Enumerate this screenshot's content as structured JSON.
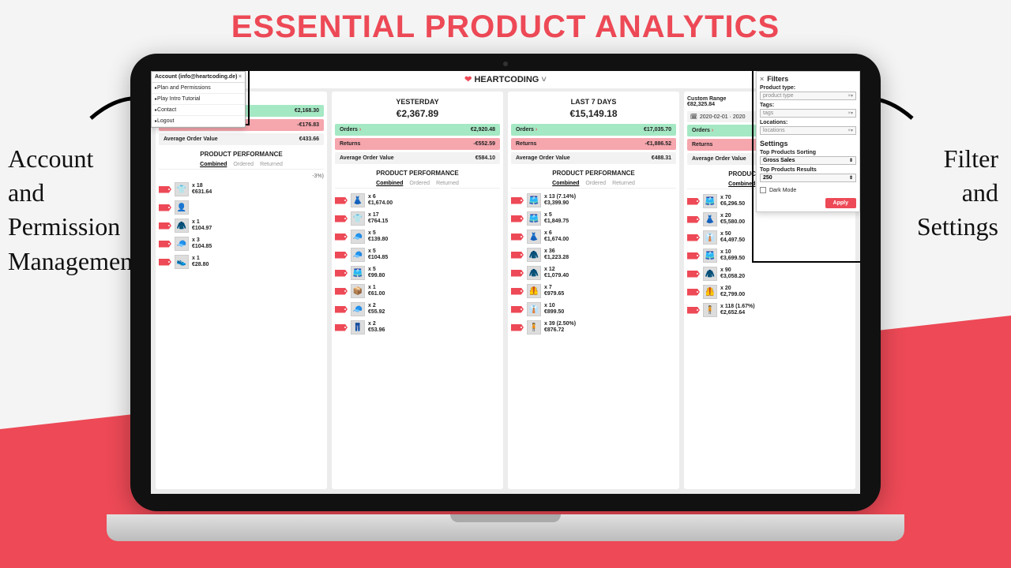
{
  "headline": "ESSENTIAL PRODUCT ANALYTICS",
  "brand": "HEARTCODING",
  "callout_left": "Account\nand\nPermission\nManagement",
  "callout_right": "Filter\nand\nSettings",
  "account": {
    "title": "Account (info@heartcoding.de)",
    "items": [
      "Plan and Permissions",
      "Play Intro Tutorial",
      "Contact",
      "Logout"
    ]
  },
  "labels": {
    "orders": "Orders",
    "returns": "Returns",
    "aov": "Average Order Value",
    "pp": "PRODUCT PERFORMANCE",
    "tabs": [
      "Combined",
      "Ordered",
      "Returned"
    ]
  },
  "columns": [
    {
      "title": "",
      "amount": "",
      "orders": "€2,168.30",
      "returns": "-€176.83",
      "aov": "€433.66",
      "note": "-3%)",
      "products": [
        {
          "icon": "👕",
          "qty": "x 18",
          "val": "€631.64"
        },
        {
          "icon": "👤",
          "qty": "",
          "val": ""
        },
        {
          "icon": "🧥",
          "qty": "x 1",
          "val": "€104.97"
        },
        {
          "icon": "🧢",
          "qty": "x 3",
          "val": "€104.85"
        },
        {
          "icon": "👟",
          "qty": "x 1",
          "val": "€28.80"
        }
      ]
    },
    {
      "title": "YESTERDAY",
      "amount": "€2,367.89",
      "orders": "€2,920.48",
      "returns": "-€552.59",
      "aov": "€584.10",
      "products": [
        {
          "icon": "👗",
          "qty": "x 6",
          "val": "€1,674.00"
        },
        {
          "icon": "👕",
          "qty": "x 17",
          "val": "€764.15"
        },
        {
          "icon": "🧢",
          "qty": "x 5",
          "val": "€139.80"
        },
        {
          "icon": "🧢",
          "qty": "x 5",
          "val": "€104.85"
        },
        {
          "icon": "🩳",
          "qty": "x 5",
          "val": "€99.80"
        },
        {
          "icon": "📦",
          "qty": "x 1",
          "val": "€61.00"
        },
        {
          "icon": "🧢",
          "qty": "x 2",
          "val": "€55.92"
        },
        {
          "icon": "👖",
          "qty": "x 2",
          "val": "€53.96"
        }
      ]
    },
    {
      "title": "LAST 7 DAYS",
      "amount": "€15,149.18",
      "orders": "€17,035.70",
      "returns": "-€1,886.52",
      "aov": "€488.31",
      "products": [
        {
          "icon": "🩳",
          "qty": "x 13 (7.14%)",
          "val": "€3,399.90"
        },
        {
          "icon": "🩳",
          "qty": "x 5",
          "val": "€1,849.75"
        },
        {
          "icon": "👗",
          "qty": "x 6",
          "val": "€1,674.00"
        },
        {
          "icon": "🧥",
          "qty": "x 36",
          "val": "€1,223.28"
        },
        {
          "icon": "🧥",
          "qty": "x 12",
          "val": "€1,079.40"
        },
        {
          "icon": "🦺",
          "qty": "x 7",
          "val": "€979.65"
        },
        {
          "icon": "👔",
          "qty": "x 10",
          "val": "€899.50"
        },
        {
          "icon": "🧍",
          "qty": "x 39 (2.50%)",
          "val": "€876.72"
        }
      ]
    },
    {
      "title_custom": "Custom Range",
      "amount_custom": "€82,325.84",
      "date": "2020-02-01 · 2020",
      "orders": "",
      "returns": "",
      "aov": "",
      "products": [
        {
          "icon": "🩳",
          "qty": "x 70",
          "val": "€6,296.50"
        },
        {
          "icon": "👗",
          "qty": "x 20",
          "val": "€5,580.00"
        },
        {
          "icon": "👔",
          "qty": "x 50",
          "val": "€4,497.50"
        },
        {
          "icon": "🩳",
          "qty": "x 10",
          "val": "€3,699.50"
        },
        {
          "icon": "🧥",
          "qty": "x 90",
          "val": "€3,058.20"
        },
        {
          "icon": "🦺",
          "qty": "x 20",
          "val": "€2,799.00"
        },
        {
          "icon": "🧍",
          "qty": "x 118 (1.67%)",
          "val": "€2,652.64"
        }
      ]
    }
  ],
  "filters": {
    "title": "Filters",
    "product_type_label": "Product type:",
    "product_type_ph": "product type",
    "tags_label": "Tags:",
    "tags_ph": "tags",
    "locations_label": "Locations:",
    "locations_ph": "locations",
    "settings": "Settings",
    "sort_label": "Top Products Sorting",
    "sort_value": "Gross Sales",
    "results_label": "Top Products Results",
    "results_value": "250",
    "dark": "Dark Mode",
    "apply": "Apply"
  }
}
